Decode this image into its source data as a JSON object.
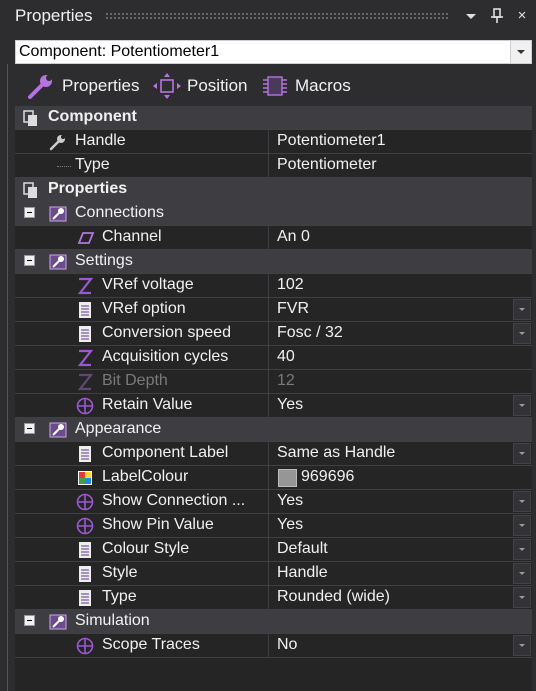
{
  "panel": {
    "title": "Properties",
    "close_glyph": "×"
  },
  "component_select": {
    "value": "Component: Potentiometer1"
  },
  "tabs": [
    {
      "label": "Properties",
      "icon": "wrench-icon"
    },
    {
      "label": "Position",
      "icon": "move-arrows-icon"
    },
    {
      "label": "Macros",
      "icon": "chip-icon"
    }
  ],
  "rows": {
    "component_cat": "Component",
    "handle": {
      "label": "Handle",
      "value": "Potentiometer1"
    },
    "type": {
      "label": "Type",
      "value": "Potentiometer"
    },
    "properties_cat": "Properties",
    "connections": "Connections",
    "channel": {
      "label": "Channel",
      "value": "An 0"
    },
    "settings": "Settings",
    "vref_voltage": {
      "label": "VRef voltage",
      "value": "102"
    },
    "vref_option": {
      "label": "VRef option",
      "value": "FVR"
    },
    "conversion_speed": {
      "label": "Conversion speed",
      "value": "Fosc / 32"
    },
    "acquisition_cycles": {
      "label": "Acquisition cycles",
      "value": "40"
    },
    "bit_depth": {
      "label": "Bit Depth",
      "value": "12"
    },
    "retain_value": {
      "label": "Retain Value",
      "value": "Yes"
    },
    "appearance": "Appearance",
    "component_label": {
      "label": "Component Label",
      "value": "Same as Handle"
    },
    "label_colour": {
      "label": "LabelColour",
      "value": "969696",
      "swatch": "#969696"
    },
    "show_connection": {
      "label": "Show Connection ...",
      "value": "Yes"
    },
    "show_pin_value": {
      "label": "Show Pin Value",
      "value": "Yes"
    },
    "colour_style": {
      "label": "Colour Style",
      "value": "Default"
    },
    "style": {
      "label": "Style",
      "value": "Handle"
    },
    "appearance_type": {
      "label": "Type",
      "value": "Rounded (wide)"
    },
    "simulation": "Simulation",
    "scope_traces": {
      "label": "Scope Traces",
      "value": "No"
    }
  },
  "colors": {
    "background": "#252526",
    "category": "#3e3e42",
    "accent_purple": "#9b59d0"
  }
}
